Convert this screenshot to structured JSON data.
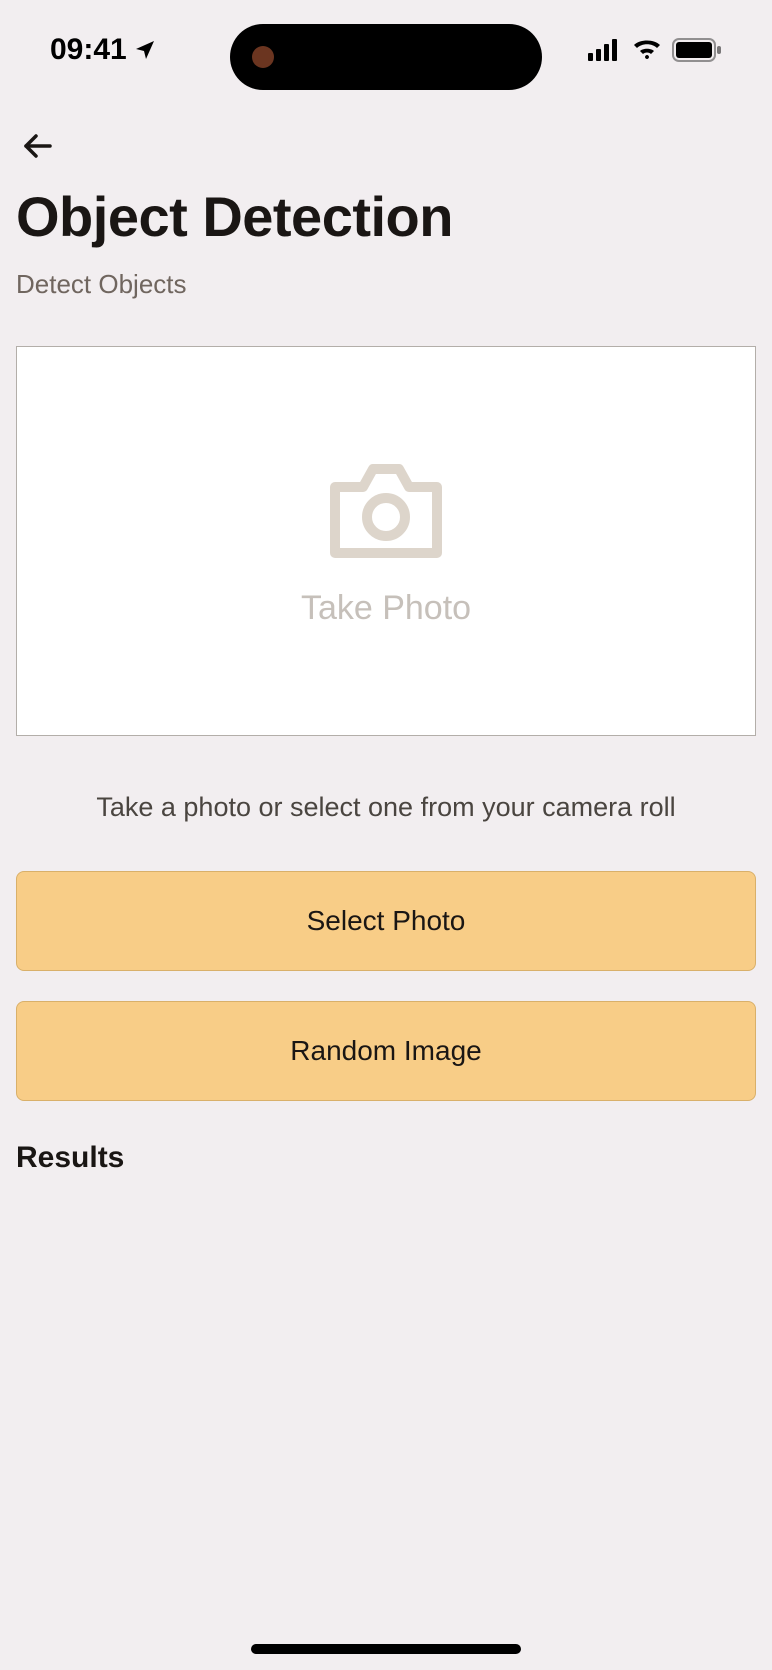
{
  "statusBar": {
    "time": "09:41"
  },
  "header": {
    "title": "Object Detection",
    "subtitle": "Detect Objects"
  },
  "photoArea": {
    "placeholder": "Take Photo"
  },
  "instruction": "Take a photo or select one from your camera roll",
  "buttons": {
    "selectPhoto": "Select Photo",
    "randomImage": "Random Image"
  },
  "results": {
    "heading": "Results"
  }
}
